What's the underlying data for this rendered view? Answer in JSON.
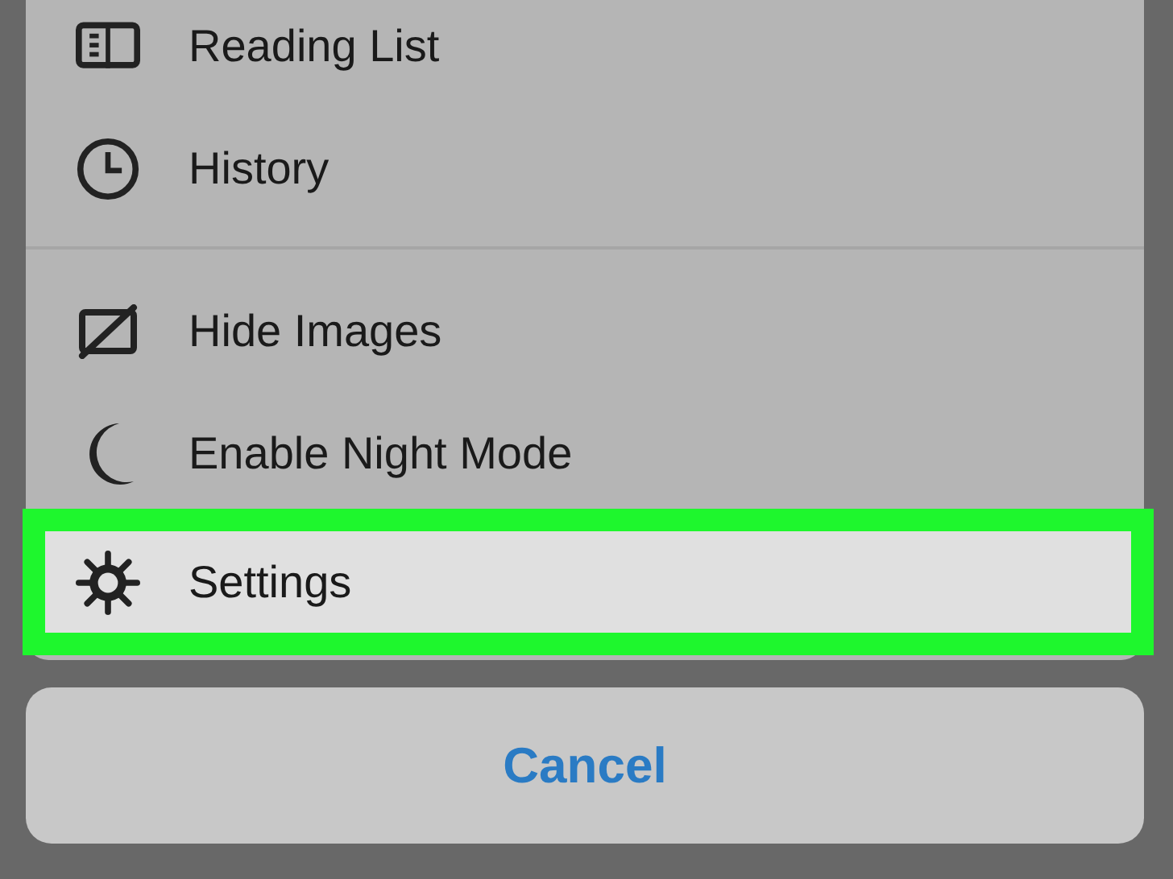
{
  "menu_groups": [
    {
      "items": [
        {
          "label": "Reading List",
          "selected": false
        },
        {
          "label": "History",
          "selected": false
        }
      ]
    },
    {
      "items": [
        {
          "label": "Hide Images",
          "selected": false
        },
        {
          "label": "Enable Night Mode",
          "selected": false
        },
        {
          "label": "Settings",
          "selected": true
        }
      ]
    }
  ],
  "cancel_button": "Cancel"
}
